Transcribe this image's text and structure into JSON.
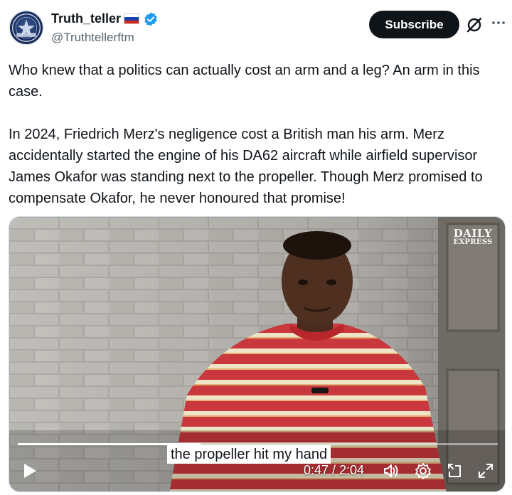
{
  "author": {
    "display_name": "Truth_teller",
    "handle": "@Truthtellerftm",
    "flag": "russia-flag-icon",
    "verified": true
  },
  "actions": {
    "subscribe_label": "Subscribe"
  },
  "tweet": {
    "paragraph1": "Who knew that a politics can actually cost an arm and a leg? An arm in this case.",
    "paragraph2": "In 2024, Friedrich Merz's negligence cost a British man his arm. Merz accidentally started the engine of his DA62 aircraft while airfield supervisor James Okafor was standing next to the propeller. Though Merz promised to compensate Okafor, he never honoured that promise!"
  },
  "video": {
    "watermark_line1": "DAILY",
    "watermark_line2": "EXPRESS",
    "caption": "the propeller hit my hand",
    "time_display": "0:47 / 2:04",
    "progress_fraction": 0.38
  },
  "colors": {
    "accent": "#0f1419",
    "verified_blue": "#1d9bf0",
    "muted": "#536471"
  }
}
